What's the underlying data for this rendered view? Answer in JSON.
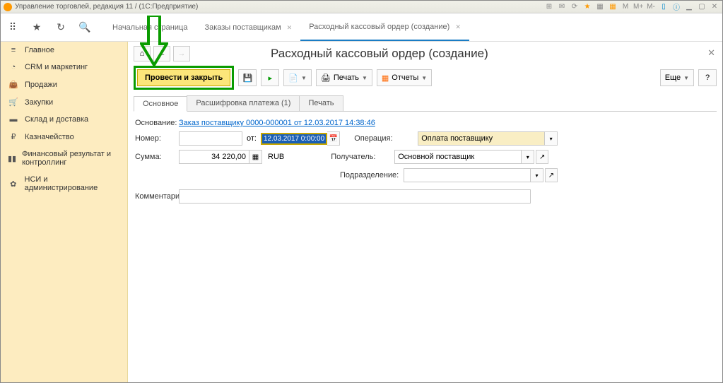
{
  "window": {
    "title": "Управление торговлей, редакция 11 / (1С:Предприятие)"
  },
  "tabs": {
    "home": "Начальная страница",
    "orders": "Заказы поставщикам",
    "cash": "Расходный кассовый ордер (создание)"
  },
  "sidebar": {
    "items": [
      {
        "icon": "menu",
        "label": "Главное"
      },
      {
        "icon": "pie",
        "label": "CRM и маркетинг"
      },
      {
        "icon": "bag",
        "label": "Продажи"
      },
      {
        "icon": "cart",
        "label": "Закупки"
      },
      {
        "icon": "box",
        "label": "Склад и доставка"
      },
      {
        "icon": "coin",
        "label": "Казначейство"
      },
      {
        "icon": "bars",
        "label": "Финансовый результат и контроллинг"
      },
      {
        "icon": "gear",
        "label": "НСИ и администрирование"
      }
    ]
  },
  "page": {
    "title": "Расходный кассовый ордер (создание)",
    "post_close": "Провести и закрыть",
    "print": "Печать",
    "reports": "Отчеты",
    "more": "Еще",
    "help": "?",
    "subtabs": {
      "main": "Основное",
      "payment": "Расшифровка платежа (1)",
      "print2": "Печать"
    }
  },
  "form": {
    "basis_lbl": "Основание:",
    "basis_val": "Заказ поставщику 0000-000001 от 12.03.2017 14:38:46",
    "num_lbl": "Номер:",
    "num_val": "",
    "from_lbl": "от:",
    "date_val": "12.03.2017  0:00:00",
    "op_lbl": "Операция:",
    "op_val": "Оплата поставщику",
    "sum_lbl": "Сумма:",
    "sum_val": "34 220,00",
    "currency": "RUB",
    "recip_lbl": "Получатель:",
    "recip_val": "Основной поставщик",
    "dept_lbl": "Подразделение:",
    "dept_val": "",
    "comment_lbl": "Комментарий:",
    "comment_val": ""
  }
}
